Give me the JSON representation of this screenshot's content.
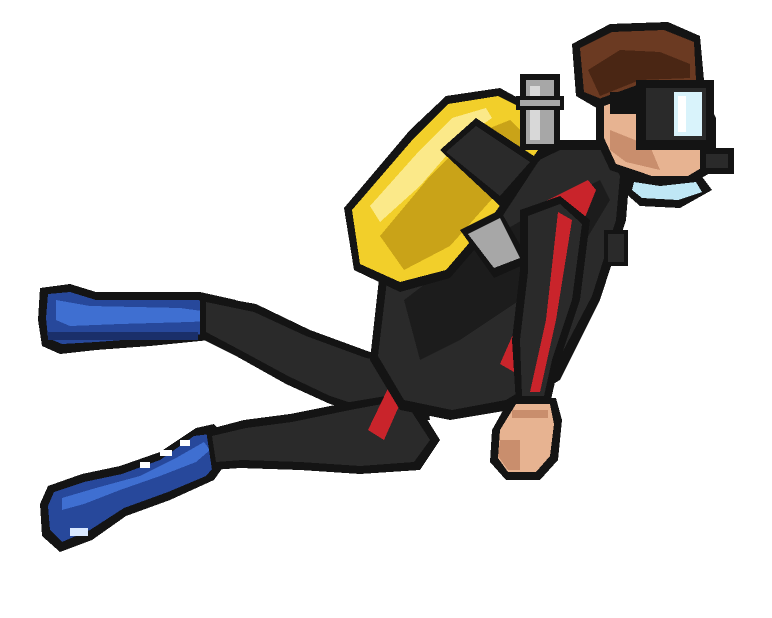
{
  "scene": {
    "background_color": "#ffffff",
    "sprite": "scuba-diver",
    "style": "pixel-art",
    "facing": "right",
    "pose": "swimming"
  },
  "palette": {
    "outline": "#141414",
    "wetsuit": "#2a2a2a",
    "wetsuit_shade": "#1c1c1c",
    "stripe": "#c9242b",
    "tank": "#f2cf2a",
    "tank_shade": "#c9a318",
    "tank_highlight": "#fbe989",
    "valve": "#a7a7a7",
    "valve_light": "#d8d8d8",
    "hair": "#6b3a22",
    "hair_dark": "#4a2614",
    "skin": "#e7b391",
    "skin_shade": "#c98e6d",
    "mask_frame": "#141414",
    "mask_glass": "#d9f3fb",
    "fins": "#27489b",
    "fins_light": "#3f6fd1",
    "fin_edge": "#1a2f6a"
  },
  "parts": [
    {
      "name": "upper-fin",
      "icon": "fin-icon"
    },
    {
      "name": "lower-fin",
      "icon": "fin-icon"
    },
    {
      "name": "legs",
      "icon": "leg-icon"
    },
    {
      "name": "torso",
      "icon": "wetsuit-icon"
    },
    {
      "name": "air-tank",
      "icon": "tank-icon"
    },
    {
      "name": "tank-valve",
      "icon": "valve-icon"
    },
    {
      "name": "head",
      "icon": "head-icon"
    },
    {
      "name": "dive-mask",
      "icon": "mask-icon"
    },
    {
      "name": "snorkel",
      "icon": "snorkel-icon"
    },
    {
      "name": "arm",
      "icon": "arm-icon"
    },
    {
      "name": "hand",
      "icon": "hand-icon"
    }
  ]
}
